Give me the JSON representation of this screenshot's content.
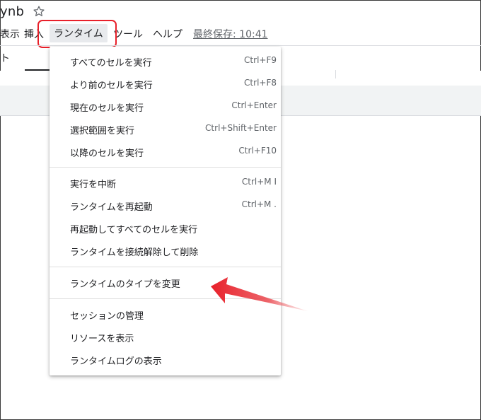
{
  "app": {
    "title": "ynb"
  },
  "menubar": {
    "items": [
      "表示",
      "挿入",
      "ランタイム",
      "ツール",
      "ヘルプ"
    ],
    "saved_label": "最終保存: 10:41"
  },
  "toolbar": {
    "partial_label": "ト"
  },
  "runtime_menu": {
    "items": [
      {
        "label": "すべてのセルを実行",
        "shortcut": "Ctrl+F9"
      },
      {
        "label": "より前のセルを実行",
        "shortcut": "Ctrl+F8"
      },
      {
        "label": "現在のセルを実行",
        "shortcut": "Ctrl+Enter"
      },
      {
        "label": "選択範囲を実行",
        "shortcut": "Ctrl+Shift+Enter"
      },
      {
        "label": "以降のセルを実行",
        "shortcut": "Ctrl+F10"
      },
      {
        "label": "実行を中断",
        "shortcut": "Ctrl+M I"
      },
      {
        "label": "ランタイムを再起動",
        "shortcut": "Ctrl+M ."
      },
      {
        "label": "再起動してすべてのセルを実行",
        "shortcut": ""
      },
      {
        "label": "ランタイムを接続解除して削除",
        "shortcut": ""
      },
      {
        "label": "ランタイムのタイプを変更",
        "shortcut": ""
      },
      {
        "label": "セッションの管理",
        "shortcut": ""
      },
      {
        "label": "リソースを表示",
        "shortcut": ""
      },
      {
        "label": "ランタイムログの表示",
        "shortcut": ""
      }
    ]
  },
  "colors": {
    "annotation": "#e8202a",
    "menu_text": "#202124",
    "shortcut_text": "#5f6368"
  },
  "icons": {
    "star": "star-outline-icon",
    "arrow": "red-pointer-arrow"
  }
}
